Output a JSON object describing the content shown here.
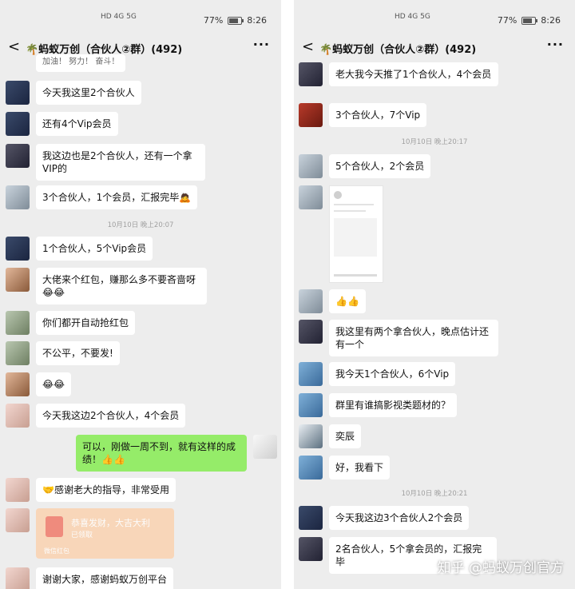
{
  "status": {
    "net": "HD 4G 5G",
    "battery": "77%",
    "time": "8:26"
  },
  "chat": {
    "title": "🌴蚂蚁万创（合伙人②群）(492)",
    "back": "<",
    "more": "···"
  },
  "left_messages": [
    {
      "text": "加油！ 努力！ 奋斗！"
    },
    {
      "text": "今天我这里2个合伙人"
    },
    {
      "text": "还有4个Vip会员"
    },
    {
      "text": "我这边也是2个合伙人，还有一个拿VIP的"
    },
    {
      "text": "3个合伙人，1个会员，汇报完毕🙇"
    },
    {
      "time": "10月10日 晚上20:07"
    },
    {
      "text": "1个合伙人，5个Vip会员"
    },
    {
      "text": "大佬来个红包，赚那么多不要吝啬呀😂😂"
    },
    {
      "text": "你们都开自动抢红包"
    },
    {
      "text": "不公平，不要发!"
    },
    {
      "text": "😂😂"
    },
    {
      "text": "今天我这边2个合伙人，4个会员"
    },
    {
      "text": "可以，刚做一周不到，就有这样的成绩！👍👍"
    },
    {
      "text": "🤝感谢老大的指导，非常受用"
    },
    {
      "redpacket": {
        "title": "恭喜发财，大吉大利",
        "sub": "已领取",
        "foot": "微信红包"
      }
    },
    {
      "text": "谢谢大家，感谢蚂蚁万创平台"
    }
  ],
  "right_messages": [
    {
      "text": "老大我今天推了1个合伙人，4个会员"
    },
    {
      "text": "3个合伙人，7个Vip"
    },
    {
      "time": "10月10日 晚上20:17"
    },
    {
      "text": "5个合伙人，2个会员"
    },
    {
      "image": "screenshot"
    },
    {
      "text": "👍👍"
    },
    {
      "text": "我这里有两个拿合伙人，晚点估计还有一个"
    },
    {
      "text": "我今天1个合伙人，6个Vip"
    },
    {
      "text": "群里有谁搞影视类题材的？"
    },
    {
      "text": "奕辰"
    },
    {
      "text": "好，我看下"
    },
    {
      "time": "10月10日 晚上20:21"
    },
    {
      "text": "今天我这边3个合伙人2个会员"
    },
    {
      "text": "2名合伙人，5个拿会员的，汇报完毕"
    }
  ],
  "watermark": "知乎 @蚂蚁万创官方"
}
